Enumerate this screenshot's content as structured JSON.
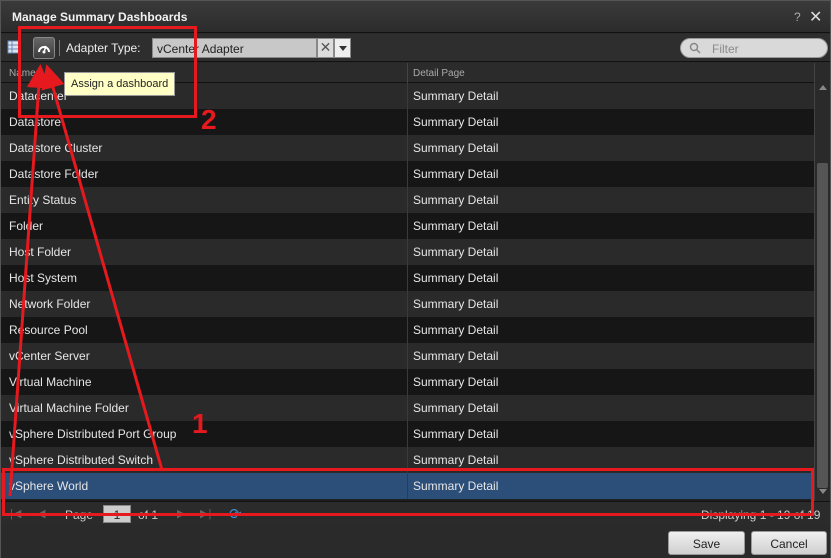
{
  "dialog": {
    "title": "Manage Summary Dashboards",
    "help": "?",
    "close": "✕"
  },
  "toolbar": {
    "adapter_label": "Adapter Type:",
    "adapter_value": "vCenter Adapter",
    "clear_glyph": "✕",
    "filter_placeholder": "Filter"
  },
  "tooltip": "Assign a dashboard",
  "grid": {
    "columns": [
      "Name",
      "Detail Page"
    ],
    "rows": [
      {
        "name": "Datacenter",
        "detail": "Summary Detail"
      },
      {
        "name": "Datastore",
        "detail": "Summary Detail"
      },
      {
        "name": "Datastore Cluster",
        "detail": "Summary Detail"
      },
      {
        "name": "Datastore Folder",
        "detail": "Summary Detail"
      },
      {
        "name": "Entity Status",
        "detail": "Summary Detail"
      },
      {
        "name": "Folder",
        "detail": "Summary Detail"
      },
      {
        "name": "Host Folder",
        "detail": "Summary Detail"
      },
      {
        "name": "Host System",
        "detail": "Summary Detail"
      },
      {
        "name": "Network Folder",
        "detail": "Summary Detail"
      },
      {
        "name": "Resource Pool",
        "detail": "Summary Detail"
      },
      {
        "name": "vCenter Server",
        "detail": "Summary Detail"
      },
      {
        "name": "Virtual Machine",
        "detail": "Summary Detail"
      },
      {
        "name": "Virtual Machine Folder",
        "detail": "Summary Detail"
      },
      {
        "name": "vSphere Distributed Port Group",
        "detail": "Summary Detail"
      },
      {
        "name": "vSphere Distributed Switch",
        "detail": "Summary Detail"
      },
      {
        "name": "vSphere World",
        "detail": "Summary Detail"
      }
    ],
    "selected_index": 15
  },
  "pager": {
    "page_label": "Page",
    "page_value": "1",
    "of_label": "of 1",
    "display_text": "Displaying 1 - 19 of 19"
  },
  "footer": {
    "save_label": "Save",
    "cancel_label": "Cancel"
  },
  "annotations": {
    "label_1": "1",
    "label_2": "2",
    "color": "#e6191e"
  },
  "colors": {
    "selected_row": "#2c4f7a",
    "refresh_icon": "#3b8fd9"
  }
}
